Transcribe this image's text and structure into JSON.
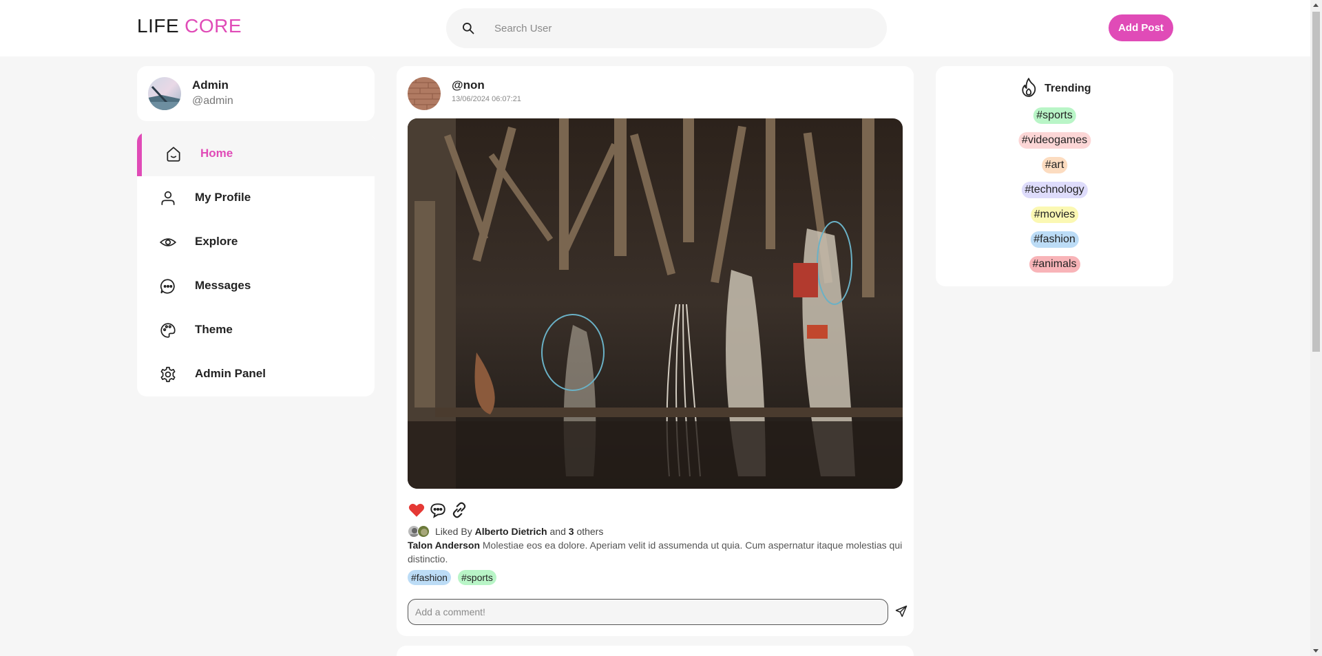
{
  "header": {
    "logo_primary": "LIFE",
    "logo_accent": "CORE",
    "search_placeholder": "Search User",
    "add_post_label": "Add Post"
  },
  "user": {
    "name": "Admin",
    "handle": "@admin"
  },
  "sidebar": {
    "items": [
      {
        "label": "Home",
        "icon": "home-icon",
        "active": true
      },
      {
        "label": "My Profile",
        "icon": "user-icon"
      },
      {
        "label": "Explore",
        "icon": "eye-icon"
      },
      {
        "label": "Messages",
        "icon": "chat-bubble-icon"
      },
      {
        "label": "Theme",
        "icon": "palette-icon"
      },
      {
        "label": "Admin Panel",
        "icon": "gear-icon"
      }
    ]
  },
  "post": {
    "author": "@non",
    "timestamp": "13/06/2024 06:07:21",
    "liked_by_prefix": "Liked By",
    "liked_by_name": "Alberto Dietrich",
    "liked_by_and": "and",
    "liked_by_count": "3",
    "liked_by_suffix": "others",
    "caption_author": "Talon Anderson",
    "caption_text": "Molestiae eos ea dolore. Aperiam velit id assumenda ut quia. Cum aspernatur itaque molestias qui distinctio.",
    "tags": [
      "#fashion",
      "#sports"
    ],
    "comment_placeholder": "Add a comment!"
  },
  "trending": {
    "title": "Trending",
    "tags": [
      {
        "label": "#sports",
        "color": "#b9f5c7"
      },
      {
        "label": "#videogames",
        "color": "#fcd6d6"
      },
      {
        "label": "#art",
        "color": "#fcdcc0"
      },
      {
        "label": "#technology",
        "color": "#dedcfb"
      },
      {
        "label": "#movies",
        "color": "#fbf8b3"
      },
      {
        "label": "#fashion",
        "color": "#bcdcf6"
      },
      {
        "label": "#animals",
        "color": "#f8b4b8"
      }
    ]
  },
  "colors": {
    "accent": "#e04bb7",
    "like": "#e53935"
  }
}
